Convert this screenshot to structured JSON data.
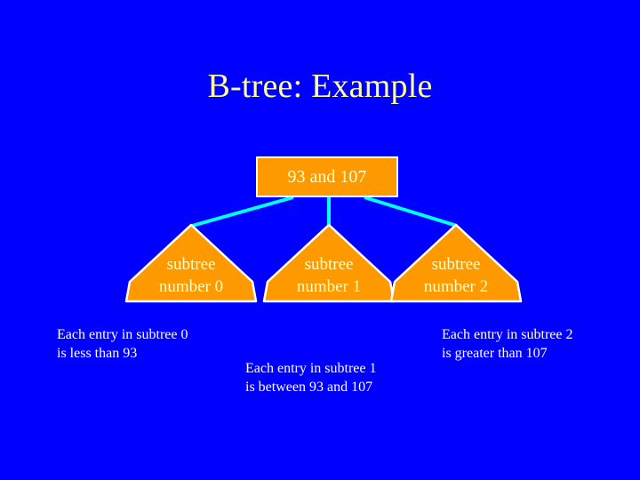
{
  "slide": {
    "title": "B-tree: Example",
    "background_color": "#0000ff",
    "title_color": "#ffff99"
  },
  "colors": {
    "node_fill": "#ff9900",
    "node_border": "#ffffff",
    "node_text": "#ffffcc",
    "connector": "#00ffff",
    "caption_text": "#ffffff"
  },
  "root": {
    "label": "93 and 107"
  },
  "subtrees": [
    {
      "line1": "subtree",
      "line2": "number 0"
    },
    {
      "line1": "subtree",
      "line2": "number 1"
    },
    {
      "line1": "subtree",
      "line2": "number 2"
    }
  ],
  "captions": [
    {
      "line1": "Each entry in subtree 0",
      "line2": "is less than 93"
    },
    {
      "line1": "Each entry in subtree 1",
      "line2": "is between 93 and 107"
    },
    {
      "line1": "Each entry in subtree 2",
      "line2": "is greater than 107"
    }
  ]
}
